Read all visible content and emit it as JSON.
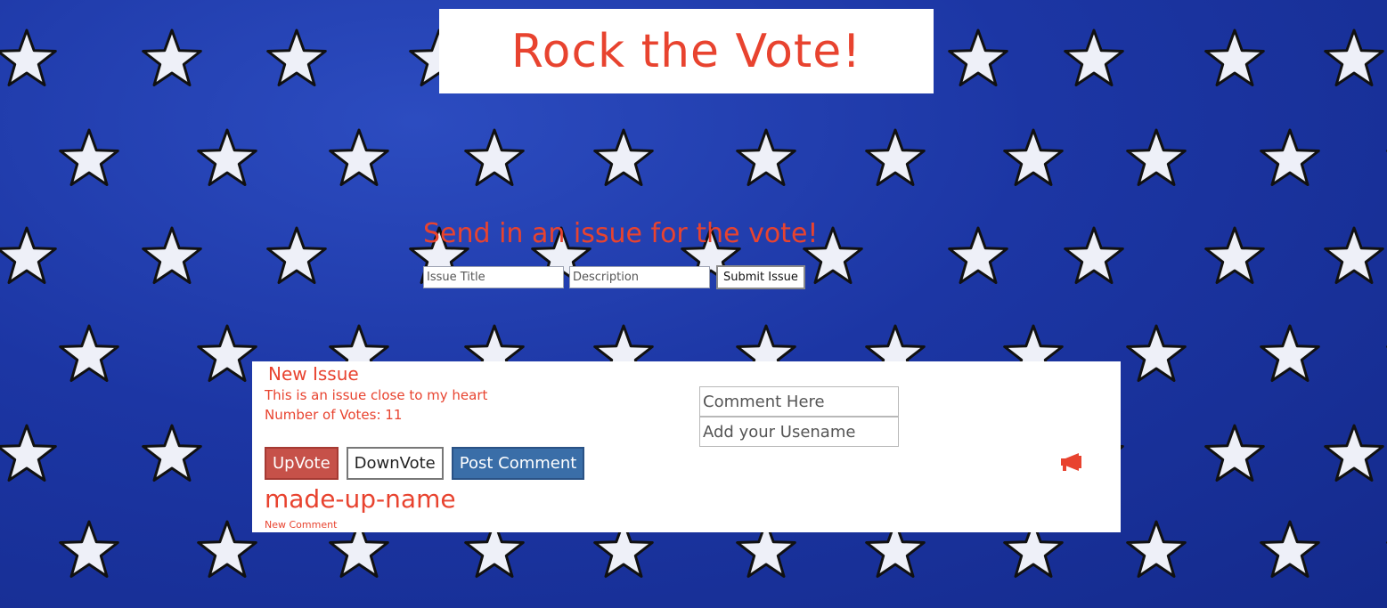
{
  "header": {
    "title": "Rock the Vote!"
  },
  "submit_form": {
    "heading": "Send in an issue for the vote!",
    "title_placeholder": "Issue Title",
    "description_placeholder": "Description",
    "submit_label": "Submit Issue"
  },
  "issue": {
    "title": "New Issue",
    "description": "This is an issue close to my heart",
    "votes_label": "Number of Votes:",
    "votes_count": "11",
    "comment_placeholder": "Comment Here",
    "username_placeholder": "Add your Usename",
    "upvote_label": "UpVote",
    "downvote_label": "DownVote",
    "post_comment_label": "Post Comment",
    "megaphone_icon": "megaphone-icon",
    "comments": [
      {
        "user": "made-up-name",
        "text": "New Comment"
      }
    ]
  },
  "colors": {
    "accent_red": "#e8432f",
    "upvote_bg": "#c65149",
    "post_bg": "#3a6ea8",
    "background_blue": "#1c36a4"
  }
}
